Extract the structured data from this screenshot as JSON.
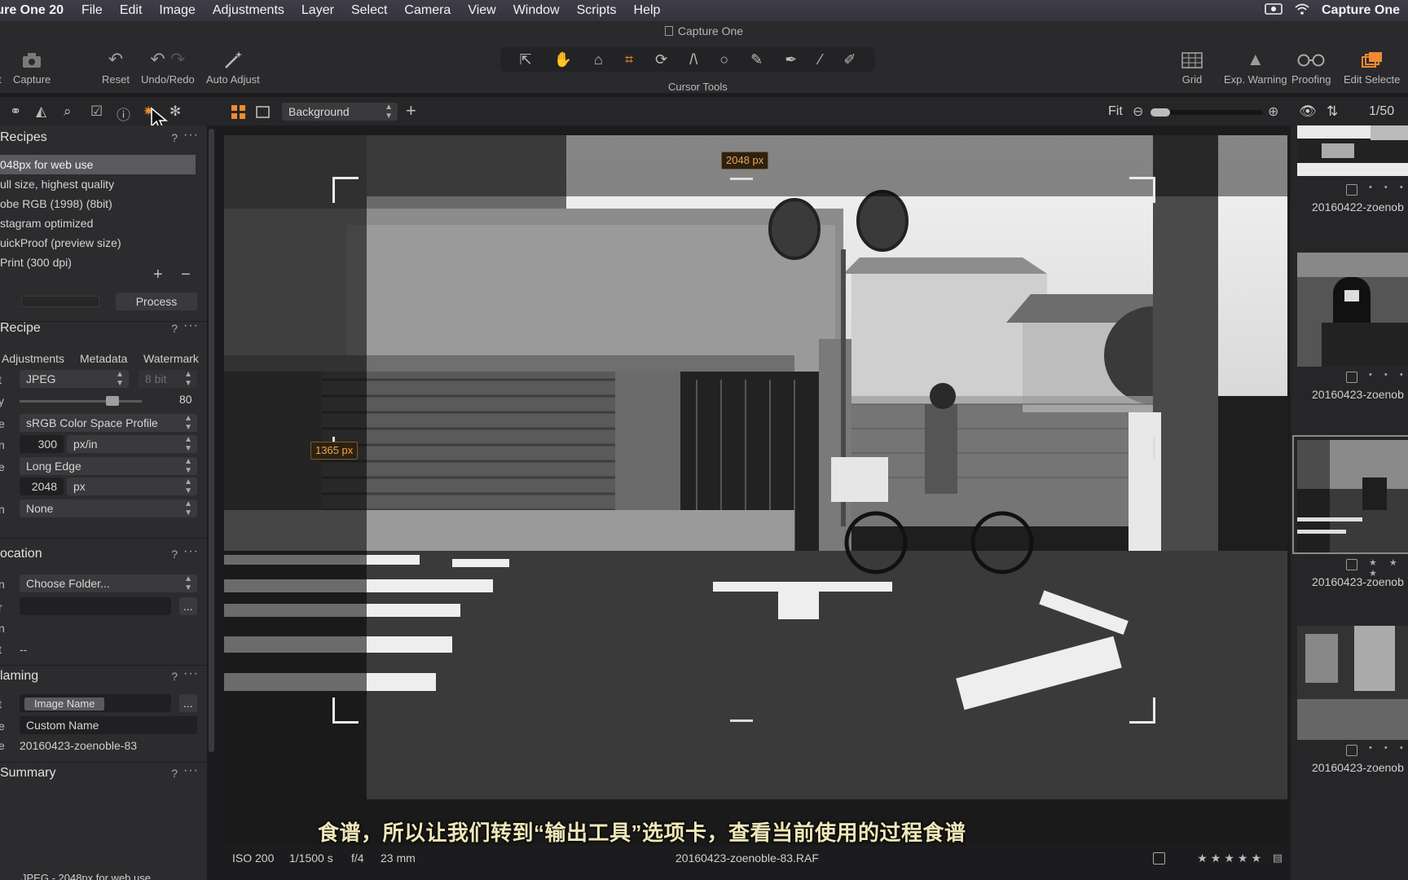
{
  "menubar": {
    "app_name": "ture One 20",
    "items": [
      "File",
      "Edit",
      "Image",
      "Adjustments",
      "Layer",
      "Select",
      "Camera",
      "View",
      "Window",
      "Scripts",
      "Help"
    ],
    "right_app": "Capture One"
  },
  "window": {
    "title": "Capture One"
  },
  "toolbar": {
    "capture": "Capture",
    "capture_prefix": "t",
    "reset": "Reset",
    "undo_redo": "Undo/Redo",
    "auto_adjust": "Auto Adjust",
    "cursor_tools": "Cursor Tools",
    "grid": "Grid",
    "exp_warning": "Exp. Warning",
    "proofing": "Proofing",
    "edit_selected": "Edit Selecte"
  },
  "tabstrip": {
    "view_select": "Background",
    "fit": "Fit",
    "counter": "1/50"
  },
  "recipes": {
    "title": "Recipes",
    "help": "?",
    "more": "···",
    "items": [
      "048px for web use",
      "ull size, highest quality",
      "obe RGB (1998) (8bit)",
      "stagram optimized",
      "uickProof (preview size)",
      "Print (300 dpi)"
    ],
    "add": "+",
    "remove": "−",
    "process": "Process"
  },
  "recipe": {
    "title": "Recipe",
    "help": "?",
    "more": "···",
    "tabs": [
      "Adjustments",
      "Metadata",
      "Watermark"
    ],
    "edge_labels": [
      "t",
      "y",
      "e",
      "n",
      "e",
      "",
      "n"
    ],
    "format": "JPEG",
    "bit_depth": "8 bit",
    "quality": "80",
    "icc_profile": "sRGB Color Space Profile",
    "resolution": "300",
    "resolution_unit": "px/in",
    "scale": "Long Edge",
    "size": "2048",
    "size_unit": "px",
    "open_with": "None"
  },
  "location": {
    "title": "ocation",
    "help": "?",
    "more": "···",
    "edge_labels": [
      "n",
      "r",
      "n",
      "t"
    ],
    "folder": "Choose Folder...",
    "subfolder": "",
    "browse": "...",
    "output": "--"
  },
  "naming": {
    "title": "laming",
    "help": "?",
    "more": "···",
    "edge_labels": [
      "t",
      "e",
      "e"
    ],
    "format_token": "Image Name",
    "browse": "...",
    "custom_name": "Custom Name",
    "sample": "20160423-zoenoble-83"
  },
  "summary": {
    "title": "Summary",
    "help": "?",
    "more": "···",
    "line": "JPEG - 2048px for web use"
  },
  "viewer": {
    "width_badge": "2048 px",
    "height_badge": "1365 px",
    "subtitle": "食谱，所以让我们转到“输出工具”选项卡，查看当前使用的过程食谱"
  },
  "infobar": {
    "iso": "ISO 200",
    "shutter": "1/1500 s",
    "aperture": "f/4",
    "focal": "23 mm",
    "filename": "20160423-zoenoble-83.RAF",
    "stars": "★★★★★"
  },
  "filmstrip": {
    "thumbs": [
      {
        "name": "20160422-zoenob",
        "stars": "• • •"
      },
      {
        "name": "20160423-zoenob",
        "stars": "• • •"
      },
      {
        "name": "20160423-zoenob",
        "stars": "★ ★ ★"
      },
      {
        "name": "20160423-zoenob",
        "stars": "• • •"
      }
    ]
  },
  "colors": {
    "accent": "#f08a30",
    "panel": "#2c2c2e",
    "background": "#1c1c1e"
  },
  "icons": {
    "tab_icons": [
      "layers-icon",
      "exposure-icon",
      "search-icon",
      "checklist-icon",
      "info-icon",
      "output-icon",
      "settings-icon"
    ]
  }
}
